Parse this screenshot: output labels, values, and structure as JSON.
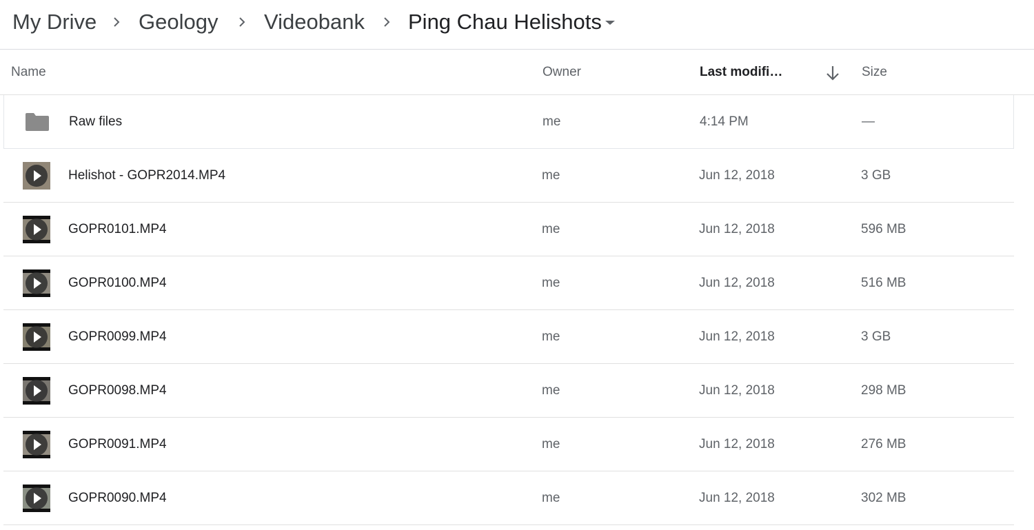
{
  "breadcrumb": {
    "items": [
      "My Drive",
      "Geology",
      "Videobank",
      "Ping Chau Helishots"
    ],
    "separator_icon": "chevron-right-icon",
    "dropdown_icon": "caret-down-icon"
  },
  "table": {
    "columns": {
      "name": "Name",
      "owner": "Owner",
      "last_modified": "Last modifi…",
      "size": "Size",
      "sort_icon": "arrow-down-icon"
    },
    "rows": [
      {
        "icon": "folder-icon",
        "name": "Raw files",
        "owner": "me",
        "modified": "4:14 PM",
        "size": "—"
      },
      {
        "icon": "video-thumbnail-icon",
        "name": "Helishot - GOPR2014.MP4",
        "owner": "me",
        "modified": "Jun 12, 2018",
        "size": "3 GB"
      },
      {
        "icon": "video-thumbnail-icon",
        "name": "GOPR0101.MP4",
        "owner": "me",
        "modified": "Jun 12, 2018",
        "size": "596 MB"
      },
      {
        "icon": "video-thumbnail-icon",
        "name": "GOPR0100.MP4",
        "owner": "me",
        "modified": "Jun 12, 2018",
        "size": "516 MB"
      },
      {
        "icon": "video-thumbnail-icon",
        "name": "GOPR0099.MP4",
        "owner": "me",
        "modified": "Jun 12, 2018",
        "size": "3 GB"
      },
      {
        "icon": "video-thumbnail-icon",
        "name": "GOPR0098.MP4",
        "owner": "me",
        "modified": "Jun 12, 2018",
        "size": "298 MB"
      },
      {
        "icon": "video-thumbnail-icon",
        "name": "GOPR0091.MP4",
        "owner": "me",
        "modified": "Jun 12, 2018",
        "size": "276 MB"
      },
      {
        "icon": "video-thumbnail-icon",
        "name": "GOPR0090.MP4",
        "owner": "me",
        "modified": "Jun 12, 2018",
        "size": "302 MB"
      }
    ]
  },
  "colors": {
    "text_primary": "#202124",
    "text_secondary": "#5f6368",
    "divider": "#e0e0e0",
    "folder": "#8a8a8a"
  }
}
